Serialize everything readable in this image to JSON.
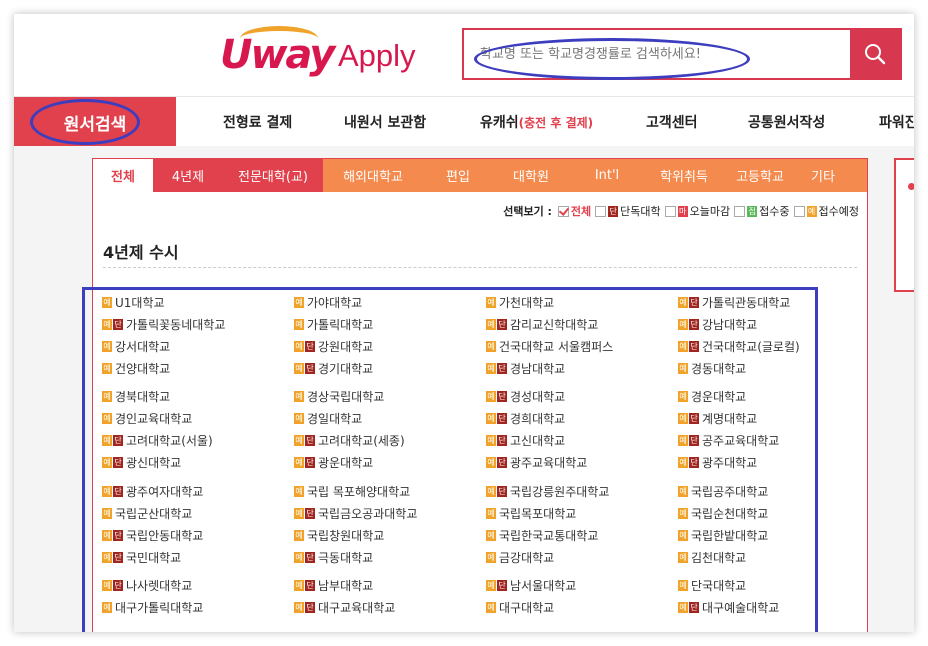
{
  "header": {
    "logo_u": "Uway",
    "logo_apply": "Apply",
    "search_placeholder": "학교명 또는 학교명경쟁률로 검색하세요!"
  },
  "nav": {
    "active": "원서검색",
    "items": [
      "전형료 결제",
      "내원서 보관함",
      "유캐쉬",
      "(충전 후 결제)",
      "고객센터",
      "공통원서작성",
      "파워진"
    ]
  },
  "tabs": [
    {
      "label": "전체",
      "style": "active"
    },
    {
      "label": "4년제",
      "style": "dark"
    },
    {
      "label": "전문대학(교)",
      "style": "dark"
    },
    {
      "label": "해외대학교",
      "style": "normal"
    },
    {
      "label": "편입",
      "style": "normal"
    },
    {
      "label": "대학원",
      "style": "normal"
    },
    {
      "label": "Int'l",
      "style": "normal"
    },
    {
      "label": "학위취득",
      "style": "normal"
    },
    {
      "label": "고등학교",
      "style": "normal"
    },
    {
      "label": "기타",
      "style": "normal"
    }
  ],
  "filters": {
    "label": "선택보기 :",
    "items": [
      {
        "label": "전체",
        "badge": "",
        "checked": true
      },
      {
        "label": "단독대학",
        "badge": "단",
        "checked": false
      },
      {
        "label": "오늘마감",
        "badge": "마",
        "checked": false
      },
      {
        "label": "접수중",
        "badge": "접",
        "checked": false
      },
      {
        "label": "접수예정",
        "badge": "예",
        "checked": false
      }
    ]
  },
  "section_title": "4년제 수시",
  "tag_labels": {
    "ye": "예",
    "dan": "단"
  },
  "universities": [
    {
      "name": "U1대학교",
      "tags": [
        "ye"
      ]
    },
    {
      "name": "가야대학교",
      "tags": [
        "ye"
      ]
    },
    {
      "name": "가천대학교",
      "tags": [
        "ye"
      ]
    },
    {
      "name": "가톨릭관동대학교",
      "tags": [
        "ye",
        "dan"
      ]
    },
    {
      "name": "가톨릭꽃동네대학교",
      "tags": [
        "ye",
        "dan"
      ]
    },
    {
      "name": "가톨릭대학교",
      "tags": [
        "ye"
      ]
    },
    {
      "name": "감리교신학대학교",
      "tags": [
        "ye",
        "dan"
      ]
    },
    {
      "name": "강남대학교",
      "tags": [
        "ye",
        "dan"
      ]
    },
    {
      "name": "강서대학교",
      "tags": [
        "ye"
      ]
    },
    {
      "name": "강원대학교",
      "tags": [
        "ye",
        "dan"
      ]
    },
    {
      "name": "건국대학교 서울캠퍼스",
      "tags": [
        "ye"
      ]
    },
    {
      "name": "건국대학교(글로컬)",
      "tags": [
        "ye",
        "dan"
      ]
    },
    {
      "name": "건양대학교",
      "tags": [
        "ye"
      ]
    },
    {
      "name": "경기대학교",
      "tags": [
        "ye",
        "dan"
      ]
    },
    {
      "name": "경남대학교",
      "tags": [
        "ye",
        "dan"
      ]
    },
    {
      "name": "경동대학교",
      "tags": [
        "ye"
      ]
    },
    {
      "name": "경북대학교",
      "tags": [
        "ye"
      ]
    },
    {
      "name": "경상국립대학교",
      "tags": [
        "ye"
      ]
    },
    {
      "name": "경성대학교",
      "tags": [
        "ye",
        "dan"
      ]
    },
    {
      "name": "경운대학교",
      "tags": [
        "ye"
      ]
    },
    {
      "name": "경인교육대학교",
      "tags": [
        "ye"
      ]
    },
    {
      "name": "경일대학교",
      "tags": [
        "ye"
      ]
    },
    {
      "name": "경희대학교",
      "tags": [
        "ye",
        "dan"
      ]
    },
    {
      "name": "계명대학교",
      "tags": [
        "ye",
        "dan"
      ]
    },
    {
      "name": "고려대학교(서울)",
      "tags": [
        "ye",
        "dan"
      ]
    },
    {
      "name": "고려대학교(세종)",
      "tags": [
        "ye",
        "dan"
      ]
    },
    {
      "name": "고신대학교",
      "tags": [
        "ye",
        "dan"
      ]
    },
    {
      "name": "공주교육대학교",
      "tags": [
        "ye",
        "dan"
      ]
    },
    {
      "name": "광신대학교",
      "tags": [
        "ye",
        "dan"
      ]
    },
    {
      "name": "광운대학교",
      "tags": [
        "ye",
        "dan"
      ]
    },
    {
      "name": "광주교육대학교",
      "tags": [
        "ye",
        "dan"
      ]
    },
    {
      "name": "광주대학교",
      "tags": [
        "ye",
        "dan"
      ]
    },
    {
      "name": "광주여자대학교",
      "tags": [
        "ye",
        "dan"
      ]
    },
    {
      "name": "국립 목포해양대학교",
      "tags": [
        "ye"
      ]
    },
    {
      "name": "국립강릉원주대학교",
      "tags": [
        "ye",
        "dan"
      ]
    },
    {
      "name": "국립공주대학교",
      "tags": [
        "ye"
      ]
    },
    {
      "name": "국립군산대학교",
      "tags": [
        "ye"
      ]
    },
    {
      "name": "국립금오공과대학교",
      "tags": [
        "ye",
        "dan"
      ]
    },
    {
      "name": "국립목포대학교",
      "tags": [
        "ye"
      ]
    },
    {
      "name": "국립순천대학교",
      "tags": [
        "ye"
      ]
    },
    {
      "name": "국립안동대학교",
      "tags": [
        "ye",
        "dan"
      ]
    },
    {
      "name": "국립창원대학교",
      "tags": [
        "ye"
      ]
    },
    {
      "name": "국립한국교통대학교",
      "tags": [
        "ye"
      ]
    },
    {
      "name": "국립한밭대학교",
      "tags": [
        "ye"
      ]
    },
    {
      "name": "국민대학교",
      "tags": [
        "ye",
        "dan"
      ]
    },
    {
      "name": "극동대학교",
      "tags": [
        "ye",
        "dan"
      ]
    },
    {
      "name": "금강대학교",
      "tags": [
        "ye"
      ]
    },
    {
      "name": "김천대학교",
      "tags": [
        "ye"
      ]
    },
    {
      "name": "나사렛대학교",
      "tags": [
        "ye",
        "dan"
      ]
    },
    {
      "name": "남부대학교",
      "tags": [
        "ye",
        "dan"
      ]
    },
    {
      "name": "남서울대학교",
      "tags": [
        "ye",
        "dan"
      ]
    },
    {
      "name": "단국대학교",
      "tags": [
        "ye"
      ]
    },
    {
      "name": "대구가톨릭대학교",
      "tags": [
        "ye"
      ]
    },
    {
      "name": "대구교육대학교",
      "tags": [
        "ye",
        "dan"
      ]
    },
    {
      "name": "대구대학교",
      "tags": [
        "ye"
      ]
    },
    {
      "name": "대구예술대학교",
      "tags": [
        "ye",
        "dan"
      ]
    }
  ]
}
